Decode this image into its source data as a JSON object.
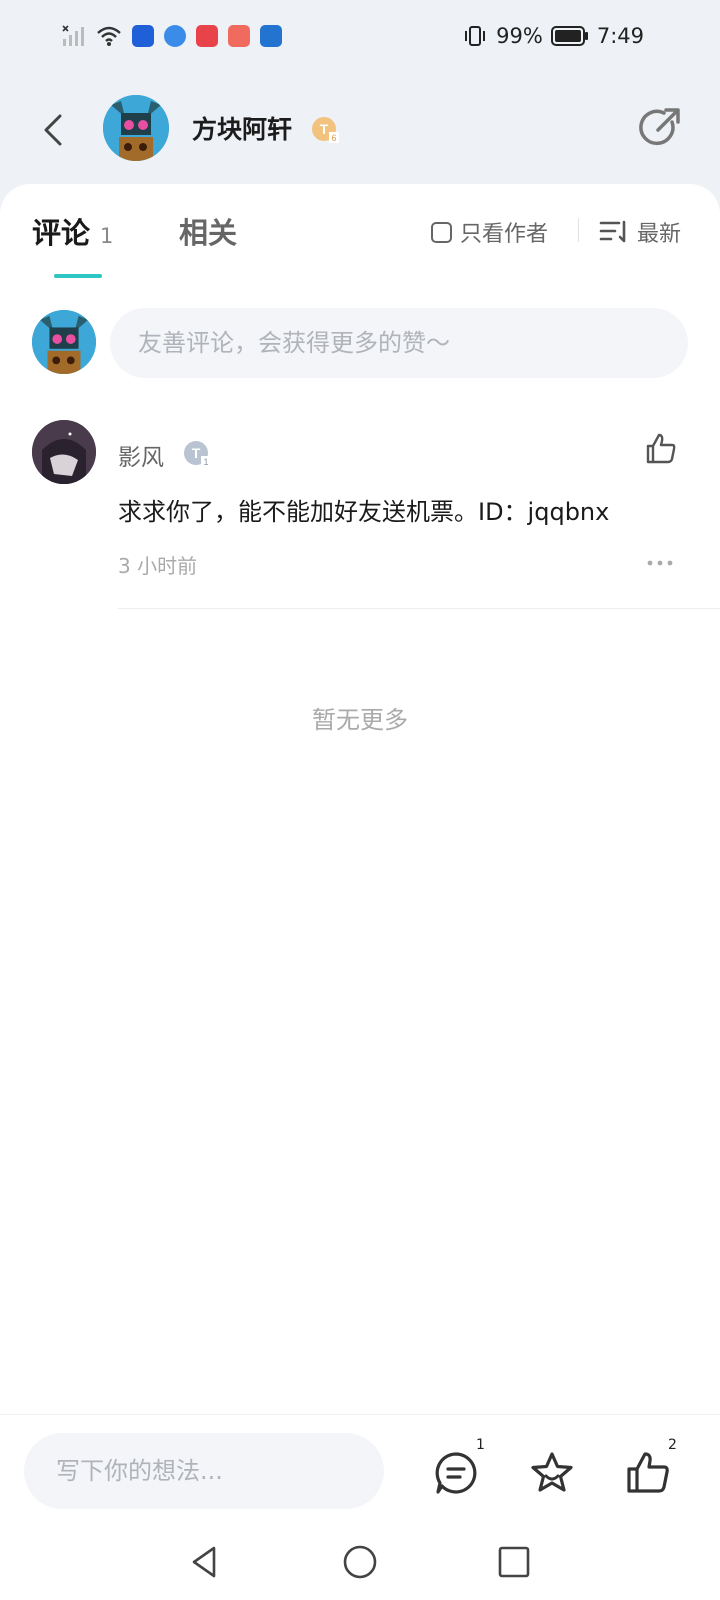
{
  "status_bar": {
    "battery": "99%",
    "time": "7:49",
    "icons": [
      "signal-icon",
      "wifi-icon",
      "app-icon-bulb",
      "app-icon-compass",
      "app-icon-book",
      "app-icon-shop",
      "app-icon-weather",
      "vibrate-icon",
      "battery-icon"
    ]
  },
  "header": {
    "author_name": "方块阿轩",
    "badge": "gold-level-badge",
    "share_icon": "share-icon",
    "back_icon": "chevron-left-icon"
  },
  "tabs": {
    "comments_label": "评论",
    "comments_count": "1",
    "related_label": "相关",
    "author_only_label": "只看作者",
    "sort_label": "最新",
    "accent": "#2ec6c4"
  },
  "comment_input": {
    "placeholder": "友善评论，会获得更多的赞～"
  },
  "comments": [
    {
      "author": "影风",
      "text": "求求你了，能不能加好友送机票。ID：jqqbnx",
      "time": "3 小时前"
    }
  ],
  "no_more_text": "暂无更多",
  "bottom_bar": {
    "placeholder": "写下你的想法...",
    "comment_count": "1",
    "like_count": "2"
  }
}
